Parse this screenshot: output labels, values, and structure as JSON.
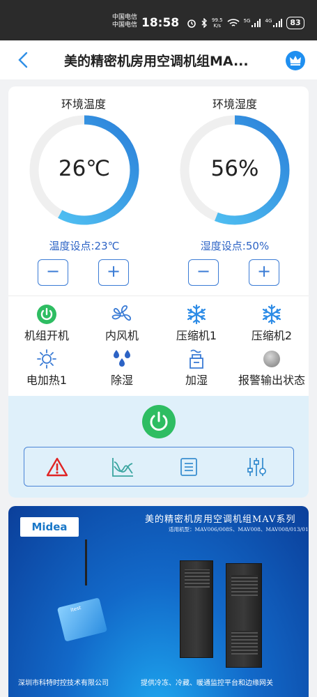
{
  "status_bar": {
    "carrier_1": "中国电信",
    "carrier_2": "中国电信",
    "time": "18:58",
    "net_speed_value": "99.5",
    "net_speed_unit": "K/s",
    "signal_1_label": "5G",
    "signal_2_label": "4G",
    "battery": "83"
  },
  "nav": {
    "title": "美的精密机房用空调机组MA...",
    "back_icon": "chevron-left-icon",
    "vip_icon": "crown-icon",
    "accent_color": "#1f8ff0"
  },
  "gauges": {
    "temperature": {
      "label": "环境温度",
      "value": "26℃",
      "fraction": 0.58,
      "setpoint": "温度设点:23℃"
    },
    "humidity": {
      "label": "环境湿度",
      "value": "56%",
      "fraction": 0.56,
      "setpoint": "湿度设点:50%"
    },
    "minus": "−",
    "plus": "+",
    "arc_color": "#2f8fe6",
    "track_color": "#efefef"
  },
  "status_items": [
    {
      "label": "机组开机",
      "icon": "power-on-icon"
    },
    {
      "label": "内风机",
      "icon": "fan-icon"
    },
    {
      "label": "压缩机1",
      "icon": "snowflake-icon"
    },
    {
      "label": "压缩机2",
      "icon": "snowflake-icon"
    },
    {
      "label": "电加热1",
      "icon": "sun-heater-icon"
    },
    {
      "label": "除湿",
      "icon": "water-drops-icon"
    },
    {
      "label": "加湿",
      "icon": "humidifier-icon"
    },
    {
      "label": "报警输出状态",
      "icon": "alarm-status-dot-icon"
    }
  ],
  "control_panel": {
    "power_icon": "power-icon",
    "tools": [
      "warning-icon",
      "trend-chart-icon",
      "list-icon",
      "settings-sliders-icon"
    ]
  },
  "banner": {
    "logo": "Midea",
    "title": "美的精密机房用空调机组MAV系列",
    "subtitle": "适用机型：MAV006/008S、MAV008、MAV008/013/018T",
    "gateway_brand": "itest",
    "footer_left": "深圳市科特时控技术有限公司",
    "footer_right": "提供冷冻、冷藏、暖通监控平台和边缘网关"
  }
}
